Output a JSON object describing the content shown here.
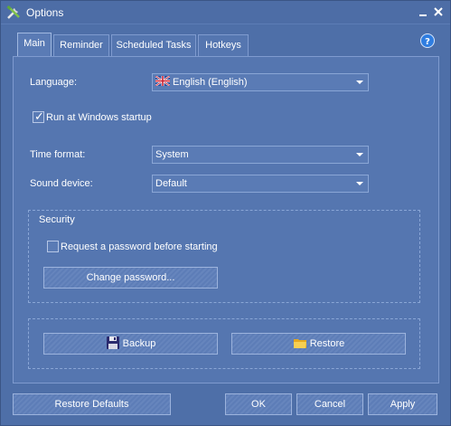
{
  "window": {
    "title": "Options"
  },
  "tabs": [
    {
      "label": "Main"
    },
    {
      "label": "Reminder"
    },
    {
      "label": "Scheduled Tasks"
    },
    {
      "label": "Hotkeys"
    }
  ],
  "main": {
    "language_label": "Language:",
    "language_value": "English (English)",
    "startup_label": "Run at Windows startup",
    "startup_checked": true,
    "time_format_label": "Time format:",
    "time_format_value": "System",
    "sound_device_label": "Sound device:",
    "sound_device_value": "Default",
    "security": {
      "title": "Security",
      "password_check_label": "Request a password before starting",
      "password_checked": false,
      "change_password_label": "Change password..."
    },
    "backup_label": "Backup",
    "restore_label": "Restore"
  },
  "footer": {
    "restore_defaults_label": "Restore Defaults",
    "ok_label": "OK",
    "cancel_label": "Cancel",
    "apply_label": "Apply"
  },
  "icons": {
    "app": "tools-icon",
    "help": "help-icon",
    "flag": "uk-flag-icon",
    "backup": "floppy-disk-icon",
    "restore": "folder-icon"
  },
  "colors": {
    "window_bg": "#4e6fa8",
    "panel_bg": "#5576b0",
    "border": "#7f9bcf"
  }
}
